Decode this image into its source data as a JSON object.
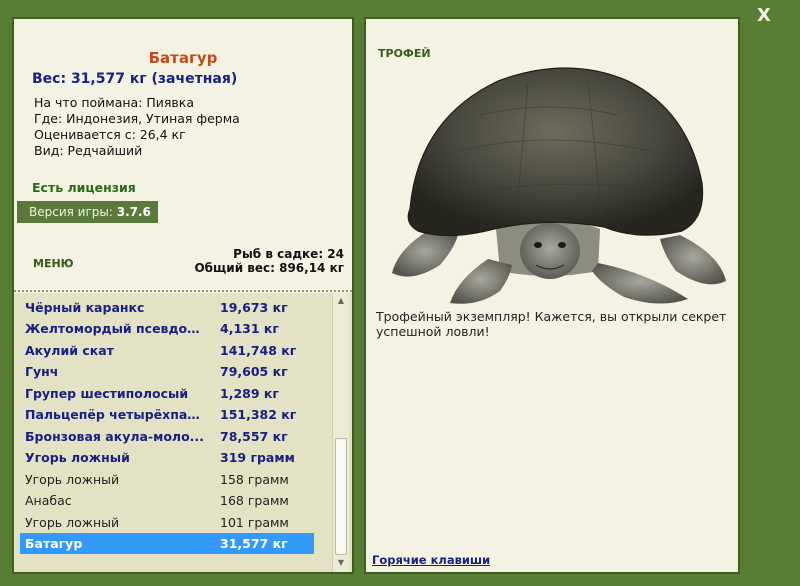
{
  "window": {
    "close_label": "X"
  },
  "fish": {
    "name": "Батагур",
    "weight_line": "Вес: 31,577 кг (зачетная)",
    "info": [
      "На что поймана: Пиявка",
      "Где: Индонезия, Утиная ферма",
      "Оценивается с: 26,4 кг",
      "Вид: Редчайший"
    ]
  },
  "license": "Есть лицензия",
  "version": {
    "label": "Версия игры:",
    "value": "3.7.6"
  },
  "menu_label": "МЕНЮ",
  "stats": {
    "count_line": "Рыб в садке: 24",
    "total_line": "Общий вес: 896,14 кг"
  },
  "catch_list": [
    {
      "name": "Чёрный каранкс",
      "weight": "19,673 кг",
      "style": "bold"
    },
    {
      "name": "Желтомордый псевдоба...",
      "weight": "4,131 кг",
      "style": "bold"
    },
    {
      "name": "Акулий скат",
      "weight": "141,748 кг",
      "style": "bold"
    },
    {
      "name": "Гунч",
      "weight": "79,605 кг",
      "style": "bold"
    },
    {
      "name": "Групер шестиполосый",
      "weight": "1,289 кг",
      "style": "bold"
    },
    {
      "name": "Пальцепёр четырёхпал...",
      "weight": "151,382 кг",
      "style": "bold"
    },
    {
      "name": "Бронзовая акула-моло...",
      "weight": "78,557 кг",
      "style": "bold"
    },
    {
      "name": "Угорь ложный",
      "weight": "319 грамм",
      "style": "bold"
    },
    {
      "name": "Угорь ложный",
      "weight": "158 грамм",
      "style": "plain"
    },
    {
      "name": "Анабас",
      "weight": "168 грамм",
      "style": "plain"
    },
    {
      "name": "Угорь ложный",
      "weight": "101 грамм",
      "style": "plain"
    },
    {
      "name": "Батагур",
      "weight": "31,577 кг",
      "style": "selected"
    }
  ],
  "scroll": {
    "up_icon": "▲",
    "down_icon": "▼"
  },
  "trophy": {
    "label": "ТРОФЕЙ",
    "text": "Трофейный экземпляр! Кажется, вы открыли секрет успешной ловли!"
  },
  "hotkeys_label": "Горячие клавиши",
  "colors": {
    "frame": "#587d35",
    "panel": "#f4f3e3",
    "list_bg": "#e3e2c4",
    "title": "#c24a1a",
    "accent_blue": "#1a2080",
    "selected": "#3399ff"
  }
}
